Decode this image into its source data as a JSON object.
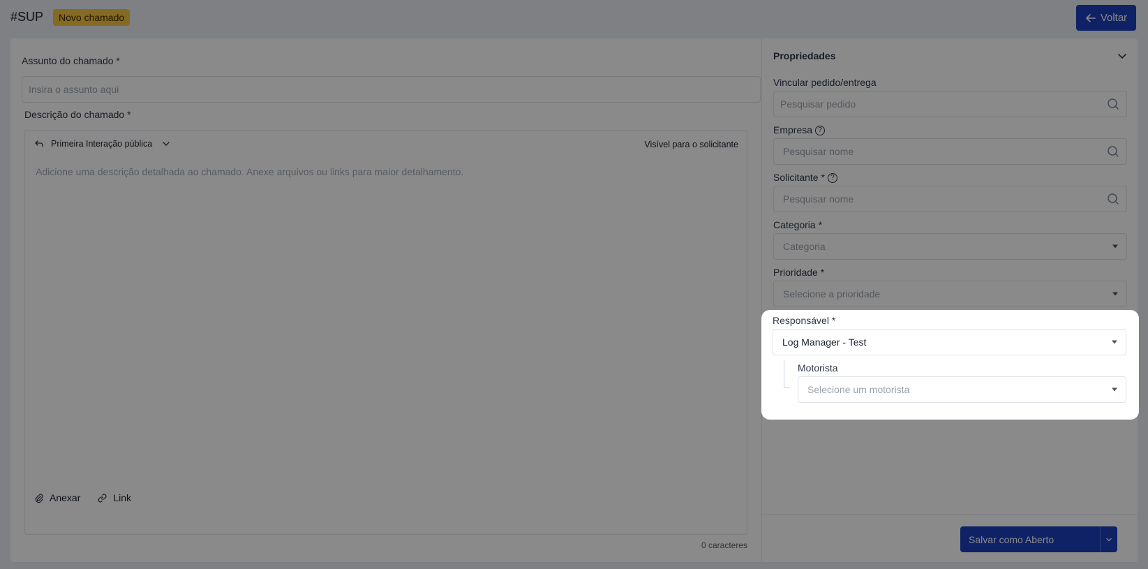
{
  "header": {
    "ticket_id": "#SUP",
    "status_badge": "Novo chamado",
    "back_button": "Voltar"
  },
  "form": {
    "subject_label": "Assunto do chamado *",
    "subject_placeholder": "Insira o assunto aqui",
    "description_label": "Descrição do chamado *",
    "editor": {
      "mode": "Primeira Interação pública",
      "visibility": "Visível para o solicitante",
      "placeholder": "Adicione uma descrição detalhada ao chamado. Anexe arquivos ou links para maior detalhamento.",
      "attach_label": "Anexar",
      "link_label": "Link"
    },
    "char_count": "0 caracteres"
  },
  "properties": {
    "title": "Propriedades",
    "order_label": "Vincular pedido/entrega",
    "order_placeholder": "Pesquisar pedido",
    "company_label": "Empresa",
    "company_placeholder": "Pesquisar nome",
    "requester_label": "Solicitante *",
    "requester_placeholder": "Pesquisar nome",
    "category_label": "Categoria *",
    "category_placeholder": "Categoria",
    "priority_label": "Prioridade *",
    "priority_placeholder": "Selecione a prioridade",
    "responsible_label": "Responsável *",
    "responsible_value": "Log Manager - Test",
    "driver_label": "Motorista",
    "driver_placeholder": "Selecione um motorista"
  },
  "footer": {
    "save_label": "Salvar como Aberto"
  },
  "colors": {
    "primary": "#1d3fbd",
    "badge": "#f6c443"
  }
}
